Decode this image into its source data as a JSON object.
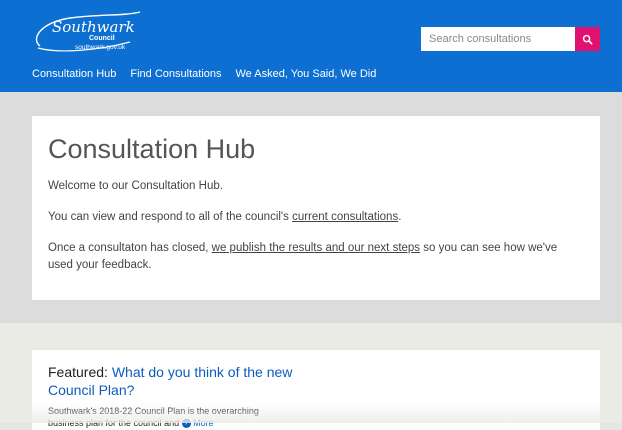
{
  "header": {
    "logo": {
      "wordmark": "Southwark",
      "council": "Council",
      "url": "southwark.gov.uk"
    },
    "search": {
      "placeholder": "Search consultations",
      "button_icon": "search-icon"
    },
    "nav": [
      {
        "label": "Consultation Hub"
      },
      {
        "label": "Find Consultations"
      },
      {
        "label": "We Asked, You Said, We Did"
      }
    ]
  },
  "hub": {
    "title": "Consultation Hub",
    "welcome": "Welcome to our Consultation Hub.",
    "p2_before": "You can view and respond to all of the council's ",
    "p2_link": "current consultations",
    "p2_after": ".",
    "p3_before": "Once a consultaton has closed, ",
    "p3_link": "we publish the results and our next steps",
    "p3_after": " so you can see how we've used your feedback."
  },
  "featured": {
    "label": "Featured:",
    "title_link": "What do you think of the new Council Plan?",
    "body": "Southwark's 2018-22 Council Plan is the overarching business plan for the council and",
    "more": "More",
    "more_icon": "chevron-right-icon"
  },
  "colors": {
    "header_bg": "#0d6fd1",
    "search_button": "#e0116f",
    "link": "#0d5bbf",
    "page_bg": "#dcdcdc"
  }
}
